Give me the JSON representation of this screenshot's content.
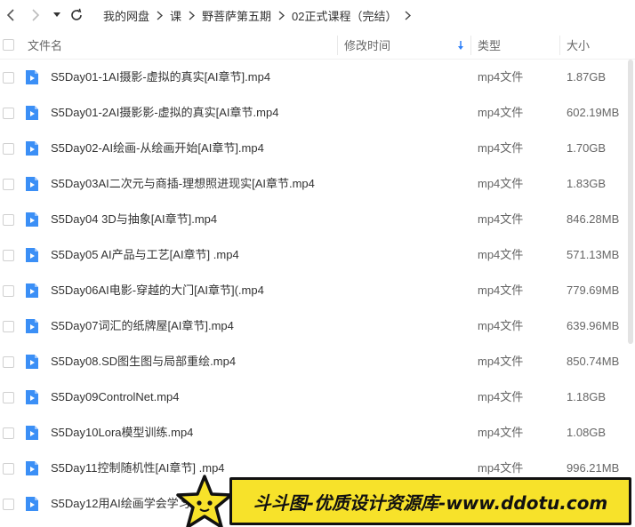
{
  "breadcrumb": {
    "items": [
      "我的网盘",
      "课",
      "野菩萨第五期",
      "02正式课程（完结）"
    ]
  },
  "columns": {
    "name": "文件名",
    "modified": "修改时间",
    "type": "类型",
    "size": "大小",
    "sort_column": "modified",
    "sort_direction": "descending"
  },
  "files": [
    {
      "name": "S5Day01-1AI摄影-虚拟的真实[AI章节].mp4",
      "type": "mp4文件",
      "size": "1.87GB"
    },
    {
      "name": "S5Day01-2AI摄影影-虚拟的真实[AI章节.mp4",
      "type": "mp4文件",
      "size": "602.19MB"
    },
    {
      "name": "S5Day02-AI绘画-从绘画开始[AI章节].mp4",
      "type": "mp4文件",
      "size": "1.70GB"
    },
    {
      "name": "S5Day03AI二次元与商插-理想照进现实[AI章节.mp4",
      "type": "mp4文件",
      "size": "1.83GB"
    },
    {
      "name": "S5Day04 3D与抽象[AI章节].mp4",
      "type": "mp4文件",
      "size": "846.28MB"
    },
    {
      "name": "S5Day05 AI产品与工艺[AI章节] .mp4",
      "type": "mp4文件",
      "size": "571.13MB"
    },
    {
      "name": "S5Day06AI电影-穿越的大门[AI章节](.mp4",
      "type": "mp4文件",
      "size": "779.69MB"
    },
    {
      "name": "S5Day07词汇的纸牌屋[AI章节].mp4",
      "type": "mp4文件",
      "size": "639.96MB"
    },
    {
      "name": "S5Day08.SD图生图与局部重绘.mp4",
      "type": "mp4文件",
      "size": "850.74MB"
    },
    {
      "name": "S5Day09ControlNet.mp4",
      "type": "mp4文件",
      "size": "1.18GB"
    },
    {
      "name": "S5Day10Lora模型训练.mp4",
      "type": "mp4文件",
      "size": "1.08GB"
    },
    {
      "name": "S5Day11控制随机性[AI章节] .mp4",
      "type": "mp4文件",
      "size": "996.21MB"
    },
    {
      "name": "S5Day12用AI绘画学会学习.mp4",
      "type": "",
      "size": ""
    }
  ],
  "watermark": {
    "text": "斗斗图-优质设计资源库-www.ddotu.com"
  },
  "colors": {
    "file_icon": "#3b8ff6",
    "sort_arrow": "#2d7ff9",
    "watermark_bg": "#f7e22a"
  },
  "icons": {
    "back": "chevron-left-icon",
    "forward": "chevron-right-icon",
    "dropdown": "caret-down-icon",
    "refresh": "refresh-icon",
    "file": "video-file-icon",
    "sort": "sort-down-arrow-icon",
    "watermark": "star-logo-icon"
  }
}
